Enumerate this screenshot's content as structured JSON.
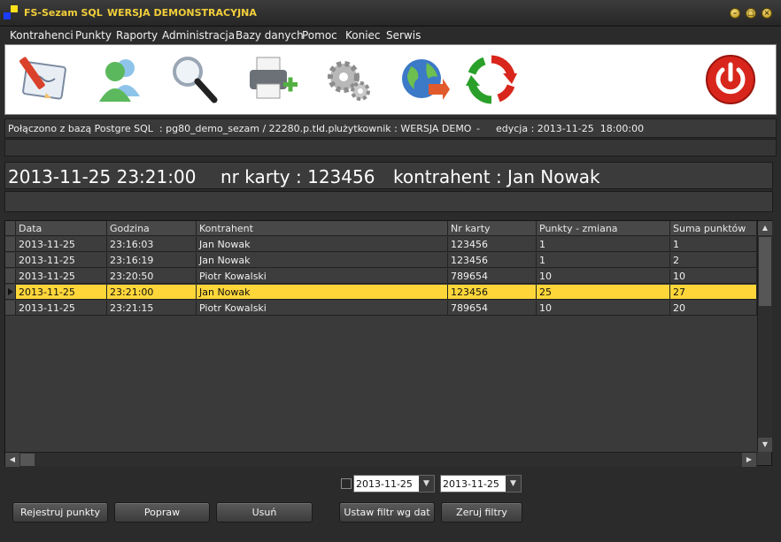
{
  "window": {
    "app_title": "FS-Sezam SQL",
    "subtitle": "WERSJA DEMONSTRACYJNA",
    "controls": [
      "minimize-icon",
      "maximize-icon",
      "close-icon"
    ]
  },
  "menu": [
    "Kontrahenci",
    "Punkty",
    "Raporty",
    "Administracja",
    "Bazy danych",
    "Pomoc",
    "Koniec",
    "Serwis"
  ],
  "toolbar": {
    "icons": [
      "document-pen-icon",
      "users-icon",
      "magnifier-icon",
      "printer-add-icon",
      "gears-icon",
      "globe-icon",
      "refresh-icon",
      "power-icon"
    ],
    "colors": {
      "power": "#d8261c",
      "refresh": "#2aa02a",
      "users": "#5cb85c",
      "pen": "#d9412b"
    }
  },
  "status": {
    "connection": "Połączono z bazą Postgre SQL  : pg80_demo_sezam / 22280.p.tld.pl",
    "sep1": "-",
    "user": "użytkownik : WERSJA DEMO",
    "sep2": "-",
    "edition": "edycja : 2013-11-25  18:00:00"
  },
  "info": {
    "datetime": "2013-11-25 23:21:00",
    "card": "nr karty : 123456",
    "contractor": "kontrahent : Jan Nowak"
  },
  "grid": {
    "columns": [
      "Data",
      "Godzina",
      "Kontrahent",
      "Nr karty",
      "Punkty - zmiana",
      "Suma punktów"
    ],
    "selected_row": 3,
    "selected_color": "#ffd63a",
    "rows": [
      [
        "2013-11-25",
        "23:16:03",
        "Jan Nowak",
        "123456",
        "1",
        "1"
      ],
      [
        "2013-11-25",
        "23:16:19",
        "Jan Nowak",
        "123456",
        "1",
        "2"
      ],
      [
        "2013-11-25",
        "23:20:50",
        "Piotr Kowalski",
        "789654",
        "10",
        "10"
      ],
      [
        "2013-11-25",
        "23:21:00",
        "Jan Nowak",
        "123456",
        "25",
        "27"
      ],
      [
        "2013-11-25",
        "23:21:15",
        "Piotr Kowalski",
        "789654",
        "10",
        "20"
      ]
    ]
  },
  "filters": {
    "date_from": "2013-11-25",
    "date_to": "2013-11-25"
  },
  "buttons": {
    "register": "Rejestruj punkty",
    "edit": "Popraw",
    "delete": "Usuń",
    "set_filter": "Ustaw filtr wg dat",
    "reset_filters": "Zeruj filtry"
  }
}
